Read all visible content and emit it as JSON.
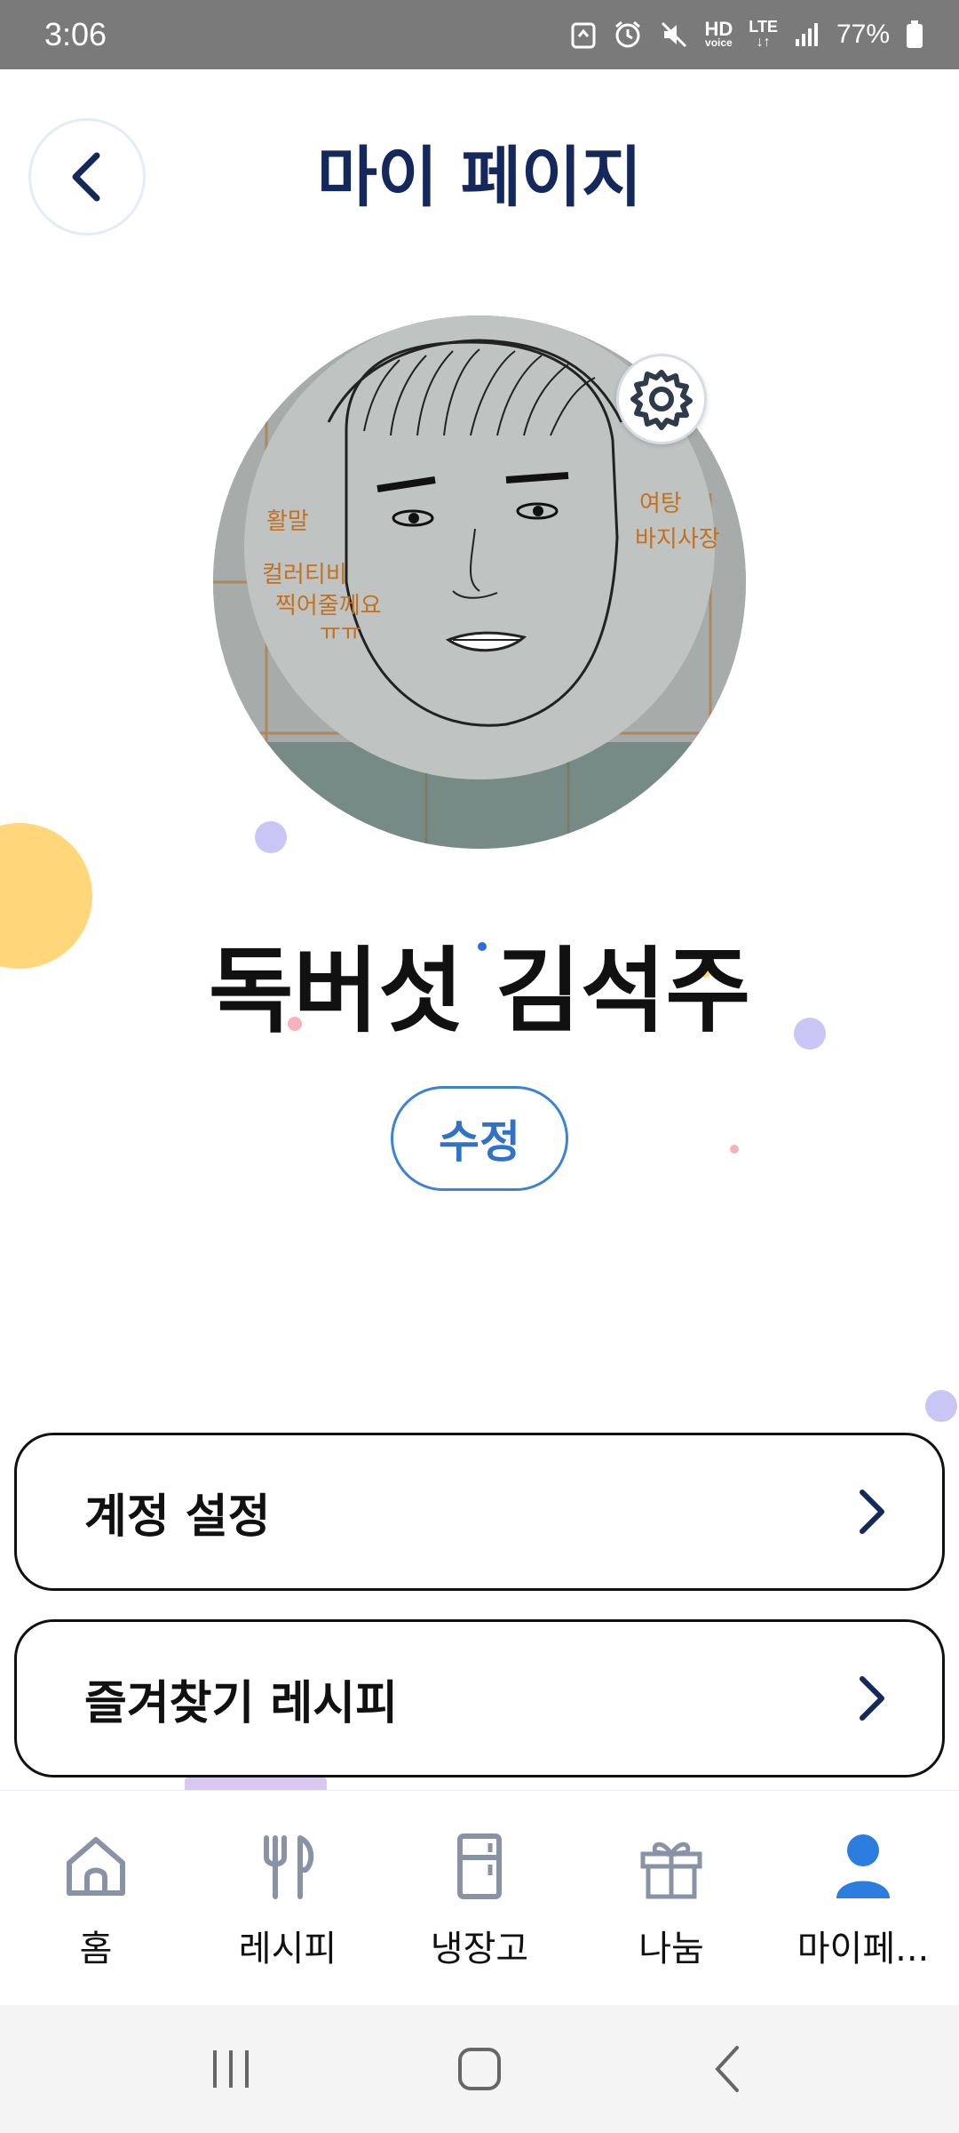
{
  "status_bar": {
    "time": "3:06",
    "network": "LTE",
    "hd_label": "HD",
    "voice_label": "voice",
    "battery": "77%"
  },
  "header": {
    "title": "마이 페이지",
    "back_icon": "chevron-left-icon"
  },
  "profile": {
    "name": "독버섯 김석주",
    "edit_label": "수정",
    "settings_icon": "gear-icon"
  },
  "menu": [
    {
      "label": "계정 설정",
      "icon": "chevron-right-icon"
    },
    {
      "label": "즐겨찾기 레시피",
      "icon": "chevron-right-icon"
    }
  ],
  "bottom_nav": [
    {
      "label": "홈",
      "icon": "home-icon",
      "active": false
    },
    {
      "label": "레시피",
      "icon": "utensils-icon",
      "active": false
    },
    {
      "label": "냉장고",
      "icon": "fridge-icon",
      "active": false
    },
    {
      "label": "나눔",
      "icon": "gift-icon",
      "active": false
    },
    {
      "label": "마이페...",
      "icon": "person-icon",
      "active": true
    }
  ],
  "colors": {
    "title": "#14285c",
    "accent": "#2f72c7",
    "active_nav": "#2b7de0",
    "inactive_nav": "#8a93a6"
  }
}
